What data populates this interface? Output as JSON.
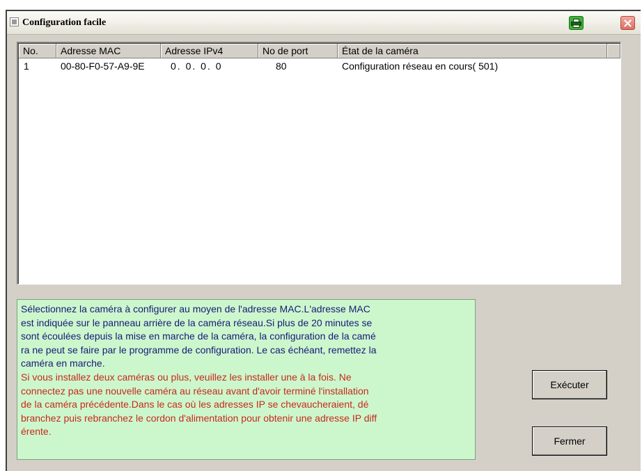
{
  "window": {
    "title": "Configuration facile",
    "icons": {
      "app": "window-icon",
      "printer": "printer-icon",
      "close": "close-icon"
    }
  },
  "table": {
    "columns": [
      "No.",
      "Adresse MAC",
      "Adresse IPv4",
      "No de port",
      "État de la caméra"
    ],
    "rows": [
      [
        "1",
        "00-80-F0-57-A9-9E",
        "0. 0. 0. 0",
        "80",
        "Configuration réseau en cours( 501)"
      ]
    ]
  },
  "info": {
    "blue_text": "Sélectionnez la caméra à configurer au moyen de l'adresse MAC.L'adresse MAC\nest indiquée sur le panneau arrière de la caméra réseau.Si plus de 20 minutes se\nsont écoulées depuis la mise en marche de la caméra, la configuration de la camé\nra ne peut se faire par le programme de configuration.  Le cas échéant, remettez la\ncaméra en marche.",
    "red_text": "Si vous installez deux caméras ou plus, veuillez les installer une à la fois. Ne\nconnectez pas une nouvelle caméra au réseau avant d'avoir terminé l'installation\nde la caméra précédente.Dans le cas où les adresses IP se chevaucheraient, dé\nbranchez puis rebranchez le cordon d'alimentation pour obtenir une adresse IP diff\nérente."
  },
  "buttons": {
    "execute": "Exécuter",
    "close": "Fermer"
  },
  "colors": {
    "info_background": "#ccf7cc",
    "info_blue_text": "#18187a",
    "info_red_text": "#c8281c",
    "printer_button": "#3fb339",
    "close_button": "#dd6e63",
    "dialog_face": "#d4d0c8"
  }
}
